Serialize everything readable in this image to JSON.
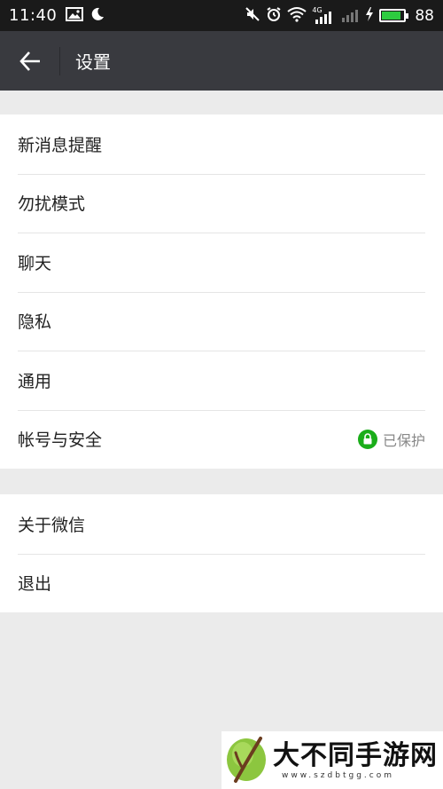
{
  "status_bar": {
    "time": "11:40",
    "network": "4G",
    "battery_level": "88",
    "battery_fraction": 0.88
  },
  "nav": {
    "title": "设置"
  },
  "settings_group_1": [
    {
      "label": "新消息提醒"
    },
    {
      "label": "勿扰模式"
    },
    {
      "label": "聊天"
    },
    {
      "label": "隐私"
    },
    {
      "label": "通用"
    },
    {
      "label": "帐号与安全",
      "status": "已保护"
    }
  ],
  "settings_group_2": [
    {
      "label": "关于微信"
    },
    {
      "label": "退出"
    }
  ],
  "watermark": {
    "title": "大不同手游网",
    "url": "www.szdbtgg.com"
  },
  "colors": {
    "nav_background": "#393a3f",
    "status_background": "#1a1a1a",
    "page_background": "#ebebeb",
    "accent_green": "#1aad19"
  }
}
